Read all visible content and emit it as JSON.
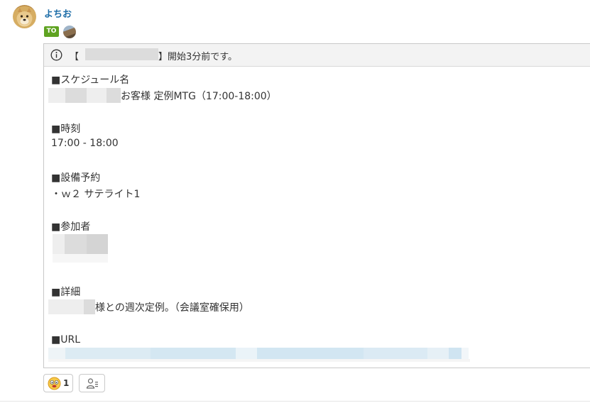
{
  "message": {
    "sender_name": "よちお",
    "to_badge": "TO",
    "header": {
      "bracket_open": "【",
      "suffix": "】開始3分前です。"
    },
    "schedule_name_heading": "■スケジュール名",
    "schedule_name_suffix": "お客様 定例MTG（17:00-18:00）",
    "time_heading": "■時刻",
    "time_value": "17:00 - 18:00",
    "equipment_heading": "■設備予約",
    "equipment_value": "・ｗ２ サテライト1",
    "attendees_heading": "■参加者",
    "details_heading": "■詳細",
    "details_suffix": "様との週次定例。（会議室確保用）",
    "url_heading": "■URL"
  },
  "reactions": {
    "emoji_icon": "smiling-face-icon",
    "emoji_count": "1",
    "member_icon": "member-list-icon"
  },
  "colors": {
    "sender": "#1f6ea8",
    "to_badge": "#5fa321",
    "header_bg": "#f3f3f3",
    "redaction": "#dcdcdc",
    "url_blur": "#d7e9f4"
  }
}
